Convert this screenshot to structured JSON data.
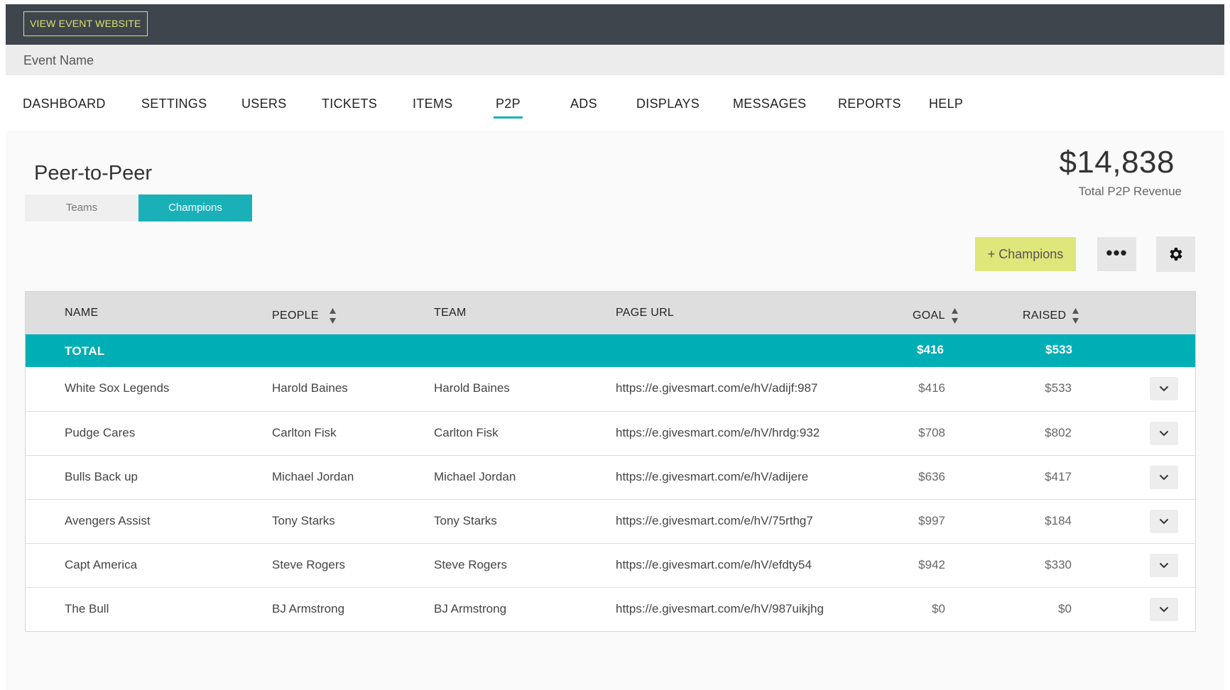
{
  "topbar": {
    "view_site_label": "VIEW EVENT WEBSITE"
  },
  "event": {
    "name": "Event Name"
  },
  "nav": {
    "items": [
      {
        "label": "DASHBOARD"
      },
      {
        "label": "SETTINGS"
      },
      {
        "label": "USERS"
      },
      {
        "label": "TICKETS"
      },
      {
        "label": "ITEMS"
      },
      {
        "label": "P2P"
      },
      {
        "label": "ADS"
      },
      {
        "label": "DISPLAYS"
      },
      {
        "label": "MESSAGES"
      },
      {
        "label": "REPORTS"
      },
      {
        "label": "HELP"
      }
    ],
    "active": "P2P"
  },
  "page": {
    "title": "Peer-to-Peer",
    "tabs": [
      {
        "label": "Teams"
      },
      {
        "label": "Champions"
      }
    ],
    "active_tab": "Champions"
  },
  "revenue": {
    "amount": "$14,838",
    "label": "Total P2P Revenue"
  },
  "toolbar": {
    "add_label": "+ Champions",
    "more_icon": "ellipsis-icon",
    "settings_icon": "gear-icon"
  },
  "table": {
    "headers": {
      "name": "NAME",
      "people": "PEOPLE",
      "team": "TEAM",
      "page_url": "PAGE URL",
      "goal": "GOAL",
      "raised": "RAISED"
    },
    "total": {
      "label": "TOTAL",
      "goal": "$416",
      "raised": "$533"
    },
    "rows": [
      {
        "name": "White Sox Legends",
        "people": "Harold Baines",
        "team": "Harold Baines",
        "url": "https://e.givesmart.com/e/hV/adijf:987",
        "goal": "$416",
        "raised": "$533"
      },
      {
        "name": "Pudge Cares",
        "people": "Carlton Fisk",
        "team": "Carlton Fisk",
        "url": "https://e.givesmart.com/e/hV/hrdg:932",
        "goal": "$708",
        "raised": "$802"
      },
      {
        "name": "Bulls Back up",
        "people": "Michael Jordan",
        "team": "Michael Jordan",
        "url": "https://e.givesmart.com/e/hV/adijere",
        "goal": "$636",
        "raised": "$417"
      },
      {
        "name": "Avengers Assist",
        "people": "Tony Starks",
        "team": "Tony Starks",
        "url": "https://e.givesmart.com/e/hV/75rthg7",
        "goal": "$997",
        "raised": "$184"
      },
      {
        "name": "Capt America",
        "people": "Steve Rogers",
        "team": "Steve Rogers",
        "url": "https://e.givesmart.com/e/hV/efdty54",
        "goal": "$942",
        "raised": "$330"
      },
      {
        "name": "The Bull",
        "people": "BJ Armstrong",
        "team": "BJ Armstrong",
        "url": "https://e.givesmart.com/e/hV/987uikjhg",
        "goal": "$0",
        "raised": "$0"
      }
    ]
  },
  "colors": {
    "accent": "#00aeb5",
    "topbar": "#3e454d",
    "add_button": "#dde77a"
  }
}
